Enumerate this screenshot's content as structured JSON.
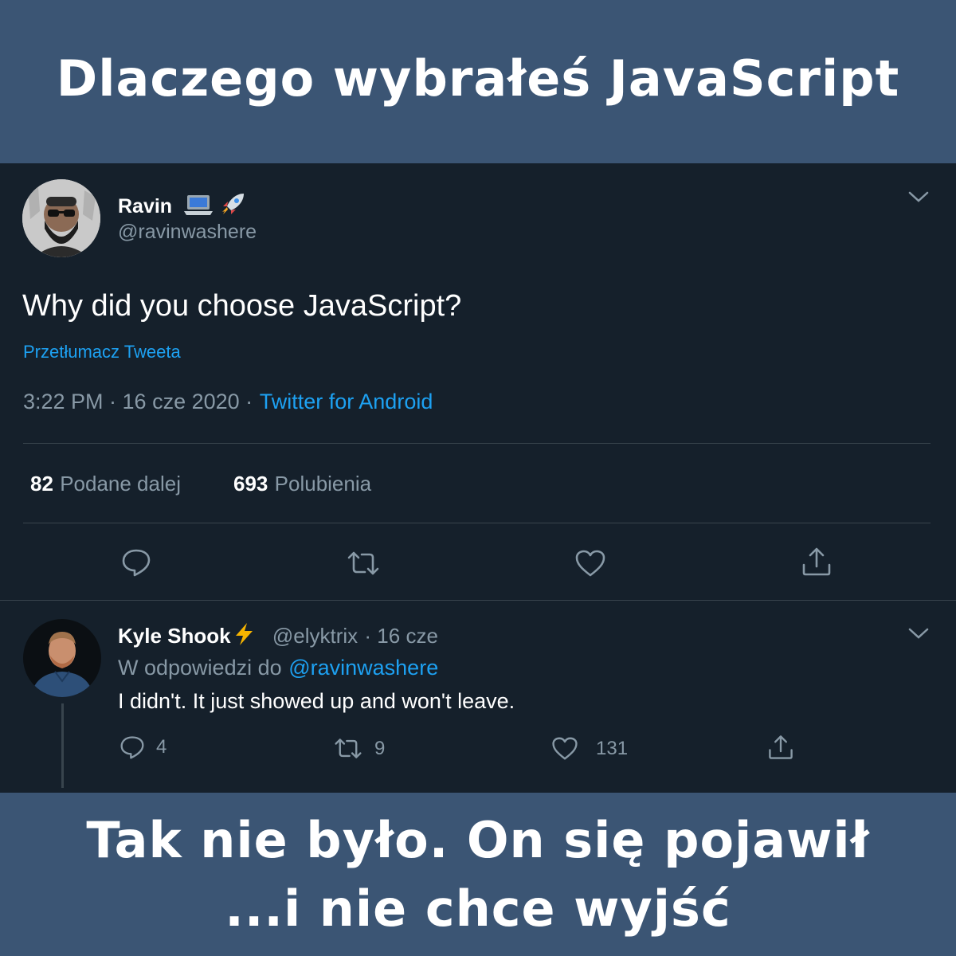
{
  "meme": {
    "top_caption": "Dlaczego wybrałeś JavaScript",
    "bottom_caption_line1": "Tak nie było. On się pojawił",
    "bottom_caption_line2": "...i nie chce wyjść"
  },
  "tweet": {
    "author_name": "Ravin",
    "author_emoji": "💻🚀",
    "author_handle": "@ravinwashere",
    "text": "Why did you choose JavaScript?",
    "translate_label": "Przetłumacz Tweeta",
    "timestamp": "3:22 PM · 16 cze 2020 ·",
    "source": "Twitter for Android",
    "retweets_count": "82",
    "retweets_label": "Podane dalej",
    "likes_count": "693",
    "likes_label": "Polubienia"
  },
  "reply": {
    "author_name": "Kyle Shook",
    "author_emoji": "⚡",
    "author_handle": "@elyktrix",
    "date": "· 16 cze",
    "replying_to_label": "W odpowiedzi do",
    "replying_to_handle": "@ravinwashere",
    "text": "I didn't. It just showed up and won't leave.",
    "reply_count": "4",
    "retweet_count": "9",
    "like_count": "131"
  },
  "colors": {
    "banner_bg": "#3b5574",
    "tweet_bg": "#15202b",
    "accent": "#1da1f2",
    "muted_text": "#8899a6",
    "divider": "#38444d"
  },
  "icons": [
    "chevron-down-icon",
    "reply-icon",
    "retweet-icon",
    "like-icon",
    "share-icon",
    "laptop-emoji",
    "rocket-emoji",
    "lightning-emoji"
  ]
}
